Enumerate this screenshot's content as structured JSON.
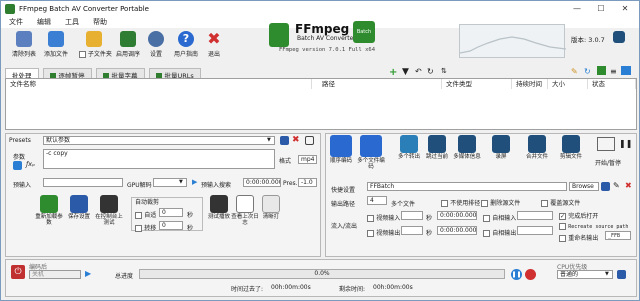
{
  "window": {
    "title": "FFmpeg Batch AV Converter Portable",
    "min": "—",
    "max": "☐",
    "close": "✕"
  },
  "menu": [
    "文件",
    "编辑",
    "工具",
    "帮助"
  ],
  "toolbar": {
    "buttons": [
      {
        "label": "清除列表",
        "color": "#5b7fbf"
      },
      {
        "label": "添加文件",
        "color": "#3a7fd4"
      },
      {
        "label": "子文件夹",
        "color": "#e8b030"
      },
      {
        "label": "启用调序",
        "color": "#2e7d32"
      },
      {
        "label": "设置",
        "color": "#4a6fa5"
      },
      {
        "label": "用户指南",
        "color": "#2a6ad0"
      },
      {
        "label": "退出",
        "color": "#d03030"
      }
    ]
  },
  "logo": {
    "title": "FFmpeg",
    "subtitle": "Batch AV Converter",
    "version": "FFmpeg version 7.0.1 Full  x64",
    "badge": "Batch"
  },
  "app_version": "版本: 3.0.7",
  "tabs": [
    "批处理",
    "逐帧暂停",
    "批量字幕",
    "批量URLs"
  ],
  "columns": [
    "文件名称",
    "路径",
    "文件类型",
    "持续时间",
    "大小",
    "状态"
  ],
  "presets": {
    "label": "Presets",
    "value": "默认参数"
  },
  "params": {
    "label": "参数",
    "value": "-c copy",
    "fx": "ƒxₚ"
  },
  "format": {
    "label": "格式",
    "value": "mp4"
  },
  "preinput": {
    "label": "预输入",
    "gpu_label": "GPU解码",
    "pre_search": "预输入搜索",
    "time1": "0:00:00.000",
    "pres_label": "Pres.",
    "pres_value": "-1.0"
  },
  "left_tools": [
    {
      "label": "重新加载参数"
    },
    {
      "label": "保存设置"
    },
    {
      "label": "在控制台上测试"
    },
    {
      "label": "测试播放"
    },
    {
      "label": "查看上次日志"
    },
    {
      "label": "清晰打"
    }
  ],
  "auto_crop": "自动裁剪",
  "crop_opts": [
    {
      "label": "自适",
      "value": "0"
    },
    {
      "label": "转移",
      "value": "0"
    }
  ],
  "sec_unit": "秒",
  "right_tools": [
    {
      "label": "顺序编码",
      "color": "#2a6ad0"
    },
    {
      "label": "多个文件编码",
      "color": "#2a6ad0"
    },
    {
      "label": "多个转出",
      "color": "#2a7fb8"
    },
    {
      "label": "跳过当前",
      "color": "#1f4f7a"
    },
    {
      "label": "多媒体信息",
      "color": "#1f4f7a"
    },
    {
      "label": "录屏",
      "color": "#1f4f7a"
    },
    {
      "label": "合并文件",
      "color": "#1f4f7a"
    },
    {
      "label": "剪辑文件",
      "color": "#1f4f7a"
    }
  ],
  "pause_label": "开始/暂停",
  "quick": {
    "label": "快捷设置",
    "value": "FFBatch",
    "browse": "Browse"
  },
  "output": {
    "label": "输出路径",
    "value": "4",
    "multi": "多个文件",
    "keep_dir": "不使用排径",
    "del_source": "删除源文件",
    "overwrite": "覆盖源文件"
  },
  "inout": {
    "label": "流入/流出",
    "video_in": "视频输入",
    "video_out": "视频输出",
    "sec": "秒",
    "time": "0:00:00.000",
    "auto_in": "自相输入",
    "auto_out": "自相输出"
  },
  "right_checks": [
    {
      "label": "完成后打开",
      "checked": true
    },
    {
      "label": "Recreate source path",
      "checked": false
    },
    {
      "label": "重命名输出",
      "checked": false,
      "suffix": "_FFB"
    }
  ],
  "status": {
    "encoder_label": "编码后",
    "encoder_value": "关机",
    "total_label": "总进度",
    "progress_text": "0.0%",
    "progress_value": 0,
    "elapsed_label": "时间过去了:",
    "elapsed_value": "00h:00m:00s",
    "remain_label": "剩余时间:",
    "remain_value": "00h:00m:00s",
    "priority_label": "CPU优先级",
    "priority_value": "普通的"
  }
}
